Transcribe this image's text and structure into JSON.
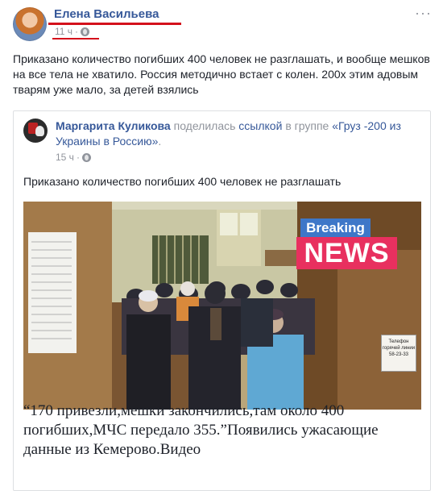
{
  "post": {
    "author": "Елена Васильева",
    "time": "11 ч",
    "separator": "·",
    "more": "···",
    "text": "Приказано количество погибших 400 человек не разглашать, и вообще мешков на все тела не хватило. Россия методично встает с колен. 200х этим адовым тварям уже мало, за детей взялись"
  },
  "shared": {
    "author": "Маргарита Куликова",
    "action": "поделилась",
    "link_word": "ссылкой",
    "in_group": "в группе",
    "group": "«Груз -200 из Украины в Россию»",
    "period": ".",
    "time": "15 ч",
    "separator": "·",
    "text": "Приказано количество погибших 400 человек не разглашать",
    "image_badge_top": "Breaking",
    "image_badge_bottom": "NEWS",
    "image_sign": "Телефон горячей линии 58-23-33",
    "link_title": "“170 привезли,мешки закончились,там около 400 погибших,МЧС передало 355.”Появились ужасающие данные из Кемерово.Видео"
  },
  "colors": {
    "link": "#365899",
    "meta": "#90949c",
    "highlight": "#d4111c",
    "badge_blue": "#3e77c8",
    "badge_pink": "#e8305f"
  },
  "icons": {
    "privacy": "globe-icon",
    "options": "more-options-icon"
  }
}
